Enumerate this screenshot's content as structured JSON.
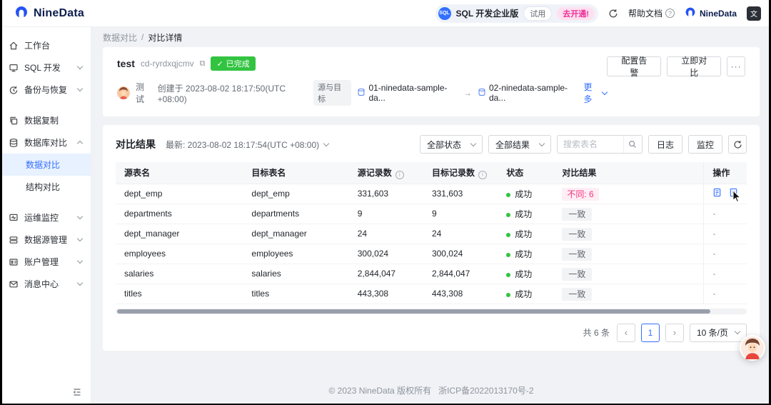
{
  "header": {
    "logo_text": "NineData",
    "plan": {
      "icon_text": "SQL",
      "label": "SQL 开发企业版",
      "trial_tag": "试用",
      "upgrade_tag": "去开通!"
    },
    "help_label": "帮助文档",
    "brand_label": "NineData",
    "translate_glyph": "文"
  },
  "sidebar": {
    "items": [
      {
        "label": "工作台"
      },
      {
        "label": "SQL 开发"
      },
      {
        "label": "备份与恢复"
      },
      {
        "label": "数据复制"
      },
      {
        "label": "数据库对比"
      },
      {
        "label": "运维监控"
      },
      {
        "label": "数据源管理"
      },
      {
        "label": "账户管理"
      },
      {
        "label": "消息中心"
      }
    ],
    "sub_items": [
      {
        "label": "数据对比"
      },
      {
        "label": "结构对比"
      }
    ]
  },
  "breadcrumb": {
    "parent": "数据对比",
    "separator": "/",
    "current": "对比详情"
  },
  "task": {
    "name": "test",
    "id": "cd-ryrdxqjcmv",
    "status_badge": "已完成",
    "creator": "测试",
    "created_at": "创建于 2023-08-02 18:17:50(UTC +08:00)",
    "pair_label": "源与目标",
    "source_ds": "01-ninedata-sample-da...",
    "target_ds": "02-ninedata-sample-da...",
    "more_link": "更多",
    "alert_button": "配置告警",
    "compare_button": "立即对比",
    "more_button": "···"
  },
  "results": {
    "title": "对比结果",
    "latest_label": "最新: 2023-08-02 18:17:54(UTC +08:00)",
    "status_filter": "全部状态",
    "result_filter": "全部结果",
    "search_placeholder": "搜索表名",
    "log_button": "日志",
    "monitor_button": "监控",
    "table": {
      "columns": [
        "源表名",
        "目标表名",
        "源记录数",
        "目标记录数",
        "状态",
        "对比结果",
        "操作"
      ],
      "rows": [
        {
          "source_table": "dept_emp",
          "target_table": "dept_emp",
          "source_count": "331,603",
          "target_count": "331,603",
          "status": "成功",
          "result": "不同: 6"
        },
        {
          "source_table": "departments",
          "target_table": "departments",
          "source_count": "9",
          "target_count": "9",
          "status": "成功",
          "result": "一致",
          "action": "-"
        },
        {
          "source_table": "dept_manager",
          "target_table": "dept_manager",
          "source_count": "24",
          "target_count": "24",
          "status": "成功",
          "result": "一致",
          "action": "-"
        },
        {
          "source_table": "employees",
          "target_table": "employees",
          "source_count": "300,024",
          "target_count": "300,024",
          "status": "成功",
          "result": "一致",
          "action": "-"
        },
        {
          "source_table": "salaries",
          "target_table": "salaries",
          "source_count": "2,844,047",
          "target_count": "2,844,047",
          "status": "成功",
          "result": "一致",
          "action": "-"
        },
        {
          "source_table": "titles",
          "target_table": "titles",
          "source_count": "443,308",
          "target_count": "443,308",
          "status": "成功",
          "result": "一致",
          "action": "-"
        }
      ]
    },
    "pagination": {
      "total": "共 6 条",
      "prev": "‹",
      "page": "1",
      "next": "›",
      "page_size": "10 条/页"
    }
  },
  "footer": {
    "copyright": "© 2023 NineData 版权所有",
    "icp": "浙ICP备2022013170号-2"
  },
  "icons": {
    "check": "✓",
    "copy": "⧉",
    "arrow": "→",
    "info": "i",
    "help": "?"
  },
  "colors": {
    "accent": "#3370ff",
    "success": "#32c441",
    "diff": "#f5317f",
    "upgrade": "#eb2f96"
  }
}
